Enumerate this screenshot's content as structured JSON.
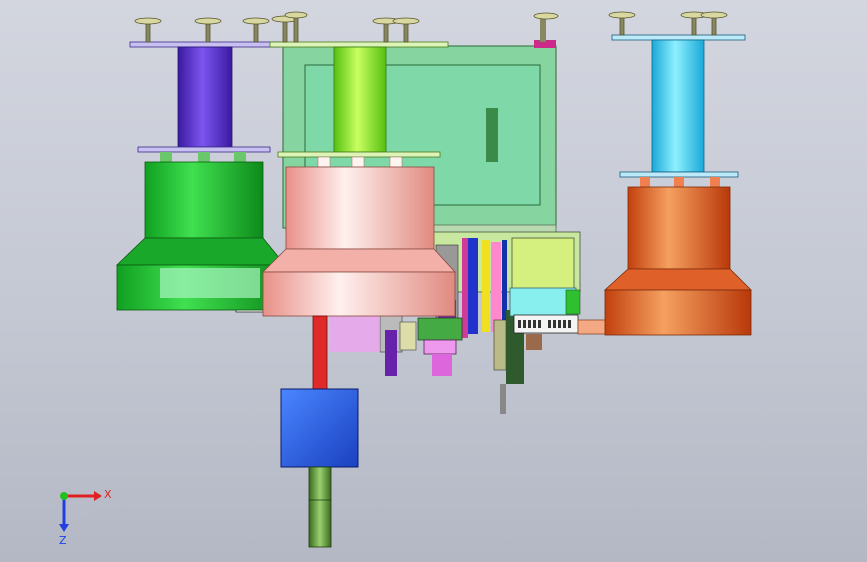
{
  "view": {
    "background_top": "#d3d6df",
    "background_bottom": "#b3b8c4"
  },
  "triad": {
    "x_label": "X",
    "z_label": "Z",
    "x_color": "#e02020",
    "y_color": "#20c020",
    "z_color": "#2040e0"
  },
  "parts": {
    "spool_left_color": "#5533cc",
    "spool_center_color": "#88ee22",
    "spool_right_color": "#33ccee",
    "hopper_left_color": "#22bb33",
    "hopper_center_color": "#f4b0a8",
    "hopper_right_color": "#e2621e",
    "frame_color": "#86d4a0",
    "motor_color": "#2a5fdd",
    "shaft_color": "#e02a2a"
  }
}
